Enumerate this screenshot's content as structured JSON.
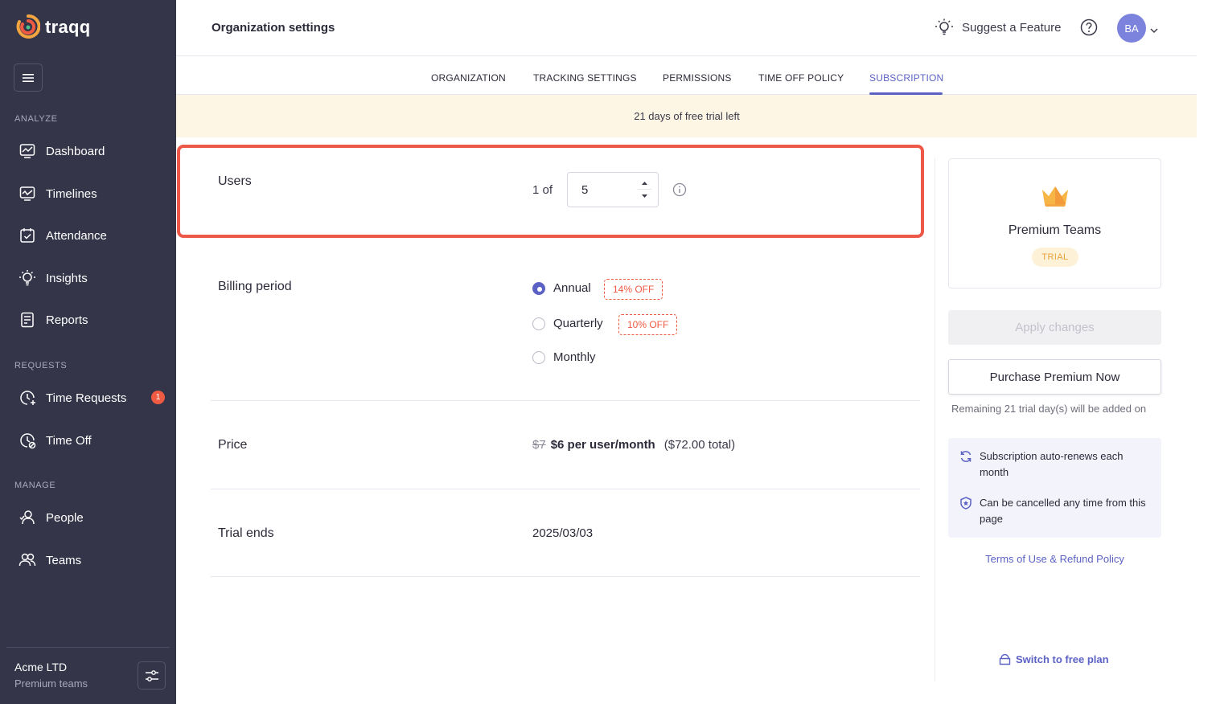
{
  "app": {
    "name": "traqq"
  },
  "sidebar": {
    "sections": [
      {
        "label": "ANALYZE"
      },
      {
        "label": "REQUESTS"
      },
      {
        "label": "MANAGE"
      }
    ],
    "items": [
      {
        "label": "Dashboard",
        "icon": "dashboard-icon"
      },
      {
        "label": "Timelines",
        "icon": "timelines-icon"
      },
      {
        "label": "Attendance",
        "icon": "attendance-icon"
      },
      {
        "label": "Insights",
        "icon": "insights-icon"
      },
      {
        "label": "Reports",
        "icon": "reports-icon"
      },
      {
        "label": "Time Requests",
        "icon": "time-requests-icon",
        "badge": "1"
      },
      {
        "label": "Time Off",
        "icon": "time-off-icon"
      },
      {
        "label": "People",
        "icon": "people-icon"
      },
      {
        "label": "Teams",
        "icon": "teams-icon"
      }
    ],
    "org": {
      "name": "Acme LTD",
      "plan": "Premium teams"
    }
  },
  "header": {
    "title": "Organization settings",
    "suggest_label": "Suggest a Feature",
    "avatar_initials": "BA"
  },
  "tabs": [
    {
      "label": "ORGANIZATION",
      "active": false
    },
    {
      "label": "TRACKING SETTINGS",
      "active": false
    },
    {
      "label": "PERMISSIONS",
      "active": false
    },
    {
      "label": "TIME OFF POLICY",
      "active": false
    },
    {
      "label": "SUBSCRIPTION",
      "active": true
    }
  ],
  "trial_banner": "21 days of free trial left",
  "subscription": {
    "users": {
      "label": "Users",
      "prefix": "1 of",
      "value": "5"
    },
    "billing": {
      "label": "Billing period",
      "options": [
        {
          "label": "Annual",
          "checked": true,
          "discount": "14% OFF"
        },
        {
          "label": "Quarterly",
          "checked": false,
          "discount": "10% OFF"
        },
        {
          "label": "Monthly",
          "checked": false,
          "discount": ""
        }
      ]
    },
    "price": {
      "label": "Price",
      "old": "$7",
      "new": "$6 per user/month",
      "total": "($72.00 total)"
    },
    "trial_ends": {
      "label": "Trial ends",
      "date": "2025/03/03"
    }
  },
  "plan_panel": {
    "plan_name": "Premium Teams",
    "badge": "TRIAL",
    "apply_label": "Apply changes",
    "purchase_label": "Purchase Premium Now",
    "remaining_note": "Remaining 21 trial day(s) will be added on",
    "info": [
      "Subscription auto-renews each month",
      "Can be cancelled any time from this page"
    ],
    "terms_label": "Terms of Use & Refund Policy",
    "switch_label": "Switch to free plan"
  },
  "colors": {
    "sidebar_bg": "#35354a",
    "accent": "#5b62c4",
    "highlight_border": "#ee5848",
    "banner_bg": "#fdf6e4",
    "discount": "#ef5a42"
  }
}
